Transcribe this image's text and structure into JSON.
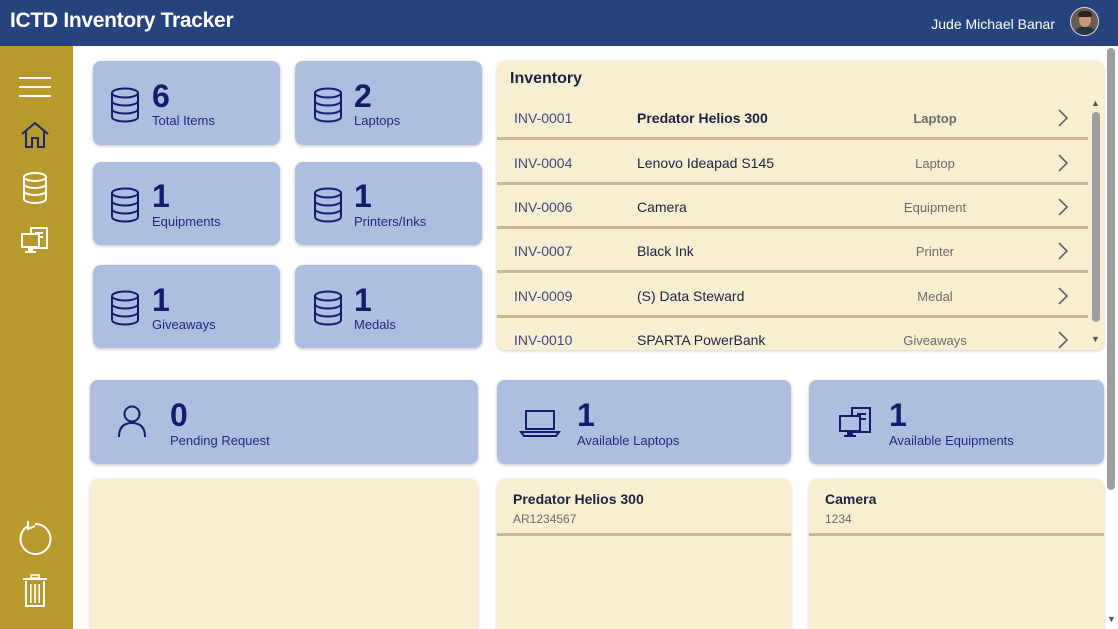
{
  "header": {
    "title": "ICTD Inventory Tracker",
    "user_name": "Jude Michael Banar"
  },
  "sidebar": {
    "items": [
      {
        "icon": "menu-icon"
      },
      {
        "icon": "home-icon"
      },
      {
        "icon": "database-icon"
      },
      {
        "icon": "computer-icon"
      },
      {
        "icon": "refresh-icon"
      },
      {
        "icon": "trash-icon"
      }
    ]
  },
  "stats": {
    "total_items": {
      "value": "6",
      "label": "Total Items"
    },
    "laptops": {
      "value": "2",
      "label": "Laptops"
    },
    "equipments": {
      "value": "1",
      "label": "Equipments"
    },
    "printers": {
      "value": "1",
      "label": "Printers/Inks"
    },
    "giveaways": {
      "value": "1",
      "label": "Giveaways"
    },
    "medals": {
      "value": "1",
      "label": "Medals"
    }
  },
  "inventory": {
    "title": "Inventory",
    "rows": [
      {
        "code": "INV-0001",
        "name": "Predator Helios 300",
        "category": "Laptop"
      },
      {
        "code": "INV-0004",
        "name": "Lenovo Ideapad S145",
        "category": "Laptop"
      },
      {
        "code": "INV-0006",
        "name": "Camera",
        "category": "Equipment"
      },
      {
        "code": "INV-0007",
        "name": "Black Ink",
        "category": "Printer"
      },
      {
        "code": "INV-0009",
        "name": "(S) Data Steward",
        "category": "Medal"
      },
      {
        "code": "INV-0010",
        "name": "SPARTA PowerBank",
        "category": "Giveaways"
      }
    ]
  },
  "summary": {
    "pending": {
      "value": "0",
      "label": "Pending Request"
    },
    "available_laptops": {
      "value": "1",
      "label": "Available Laptops"
    },
    "available_equipments": {
      "value": "1",
      "label": "Available Equipments"
    }
  },
  "available_laptop_item": {
    "name": "Predator Helios 300",
    "serial": "AR1234567"
  },
  "available_equipment_item": {
    "name": "Camera",
    "serial": "1234"
  },
  "colors": {
    "header": "#26437d",
    "sidebar": "#b8992b",
    "card": "#adbee0",
    "panel": "#faeed2",
    "accent_text": "#0f1f6b"
  }
}
